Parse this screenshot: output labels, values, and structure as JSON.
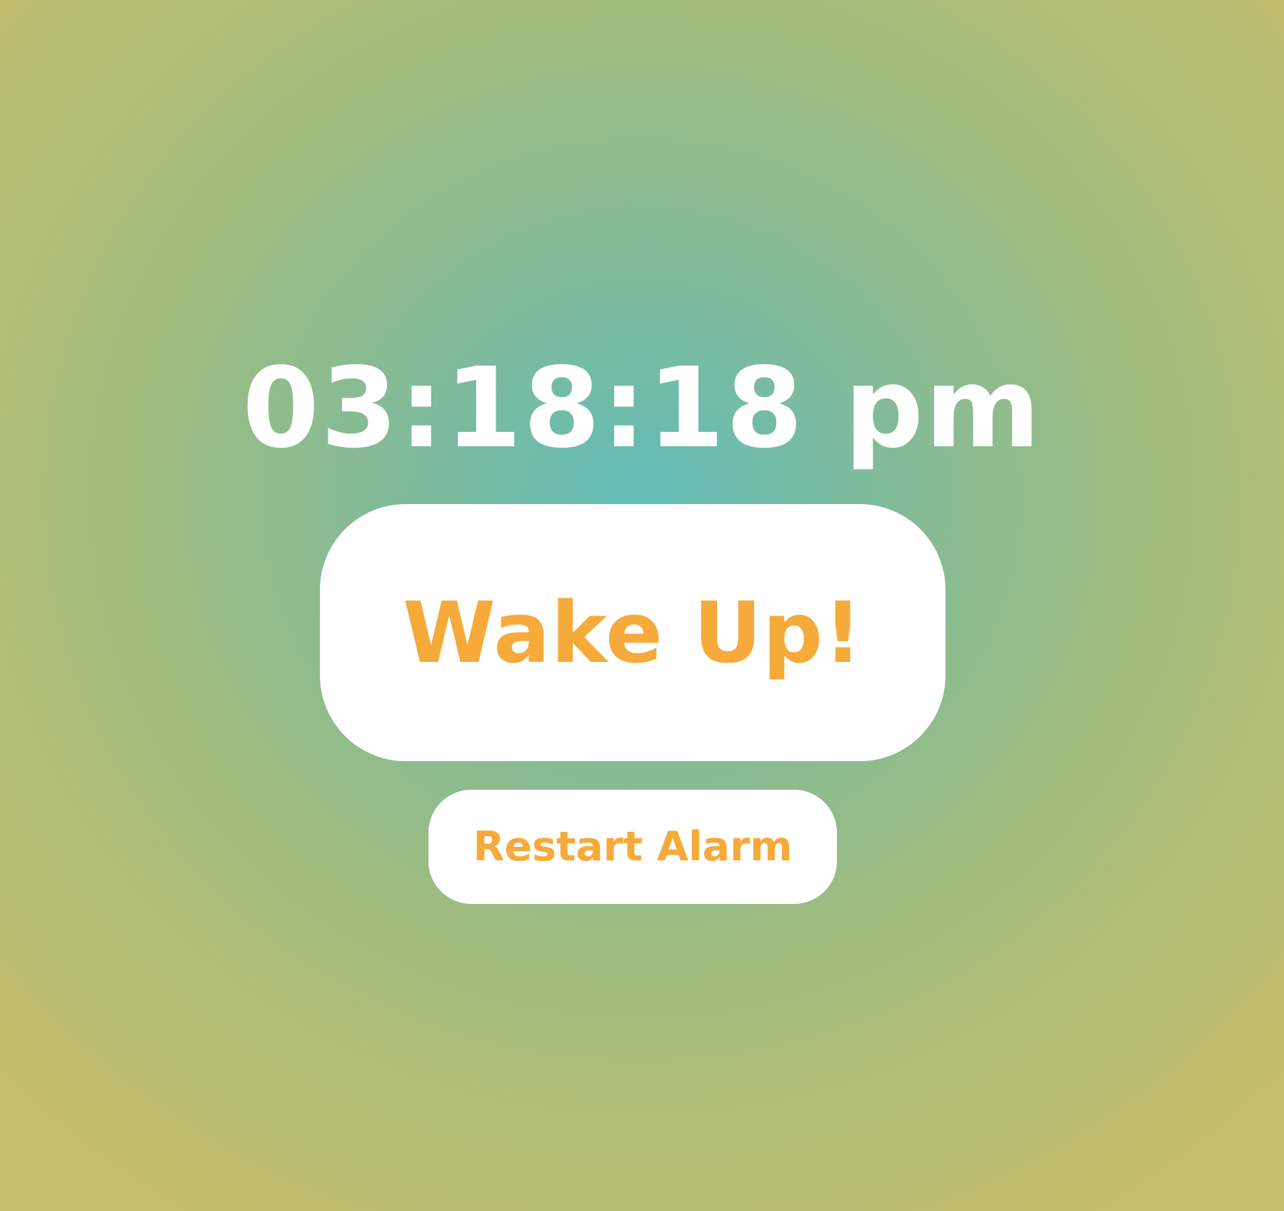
{
  "clock": {
    "time": "03:18:18 pm"
  },
  "actions": {
    "wake_label": "Wake Up!",
    "restart_label": "Restart Alarm"
  },
  "colors": {
    "accent": "#f5aa3a",
    "button_background": "#ffffff",
    "text_on_background": "#ffffff",
    "background_center": "#62bcb7",
    "background_edge": "#c6be6a"
  }
}
